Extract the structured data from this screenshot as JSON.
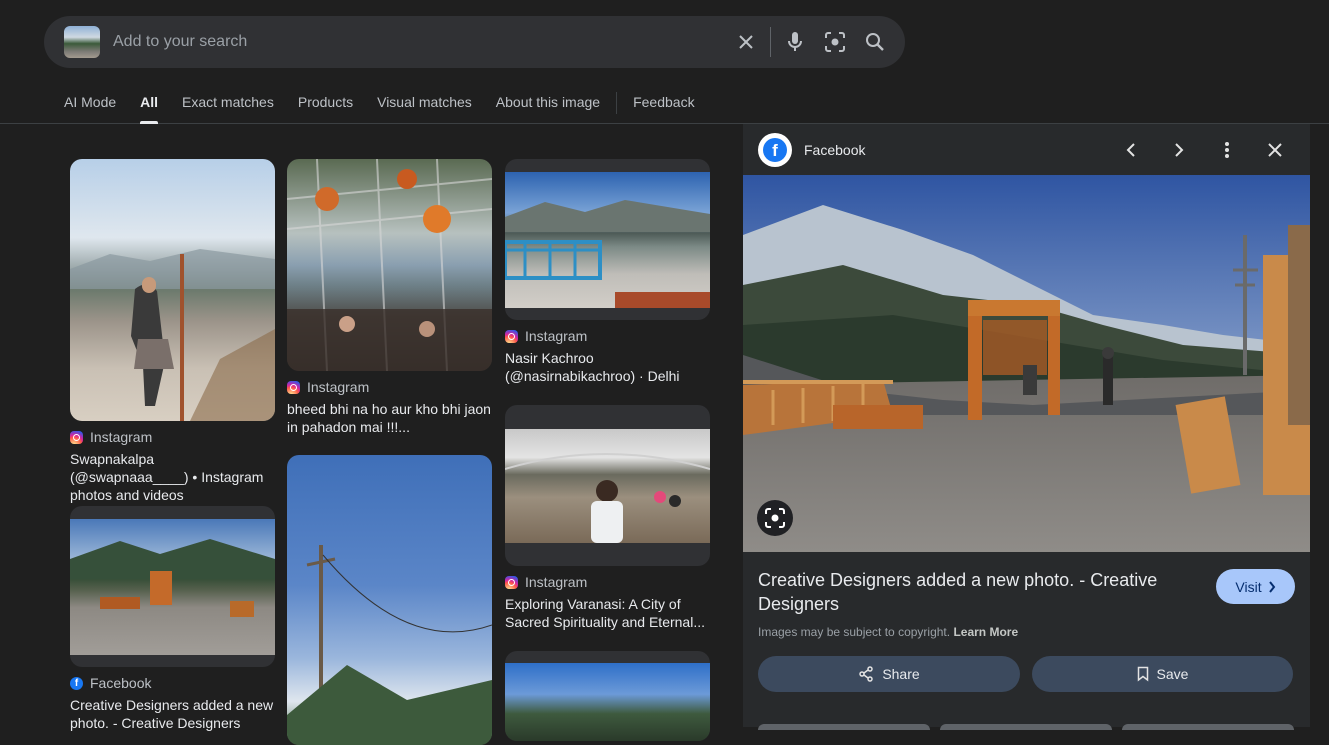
{
  "search": {
    "placeholder": "Add to your search",
    "icons": [
      "clear-icon",
      "mic-icon",
      "lens-icon",
      "search-icon"
    ]
  },
  "tabs": [
    {
      "label": "AI Mode"
    },
    {
      "label": "All",
      "active": true
    },
    {
      "label": "Exact matches"
    },
    {
      "label": "Products"
    },
    {
      "label": "Visual matches"
    },
    {
      "label": "About this image"
    },
    {
      "label": "Feedback"
    }
  ],
  "results": [
    {
      "source": "Instagram",
      "title": "Swapnakalpa (@swapnaaa____) • Instagram photos and videos"
    },
    {
      "source": "Facebook",
      "title": "Creative Designers added a new photo. - Creative Designers"
    },
    {
      "source": "Instagram",
      "title": "bheed bhi na ho aur kho bhi jaon in pahadon mai !!!..."
    },
    {
      "source": "Instagram",
      "title": "Nasir Kachroo (@nasirnabikachroo) · Delhi"
    },
    {
      "source": "Instagram",
      "title": "Exploring Varanasi: A City of Sacred Spirituality and Eternal..."
    }
  ],
  "panel": {
    "source": "Facebook",
    "title": "Creative Designers added a new photo. - Creative Designers",
    "visit_label": "Visit",
    "copyright": "Images may be subject to copyright.",
    "learn_more": "Learn More",
    "share_label": "Share",
    "save_label": "Save"
  },
  "colors": {
    "accent": "#a8c7fa",
    "background": "#1f1f1f",
    "panel": "#282a2c"
  }
}
